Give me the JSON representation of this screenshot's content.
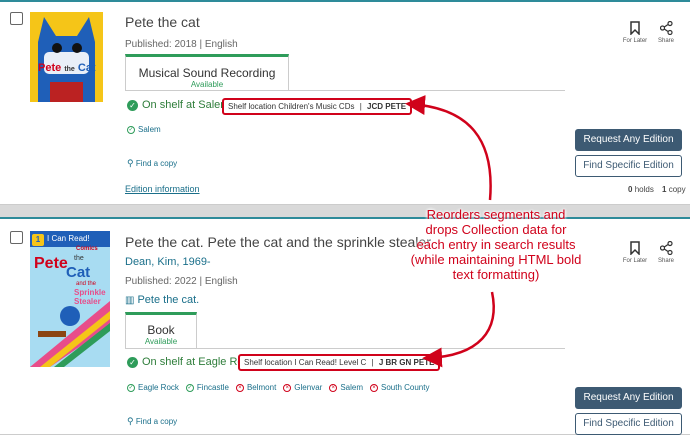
{
  "results": [
    {
      "title": "Pete the cat",
      "author": "",
      "published": "Published: 2018 | English",
      "series": "",
      "format_tab": {
        "label": "Musical Sound Recording",
        "status": "Available"
      },
      "availability": "On shelf at Salem",
      "shelf_location": {
        "prefix": "Shelf location Children's Music CDs",
        "separator": "|",
        "call_number": "JCD PETE"
      },
      "branches": [
        {
          "name": "Salem",
          "status": "available"
        }
      ],
      "find_copy": "Find a copy",
      "edition_info": "Edition information",
      "actions": {
        "for_later": "For Later",
        "share": "Share"
      },
      "buttons": {
        "request": "Request Any Edition",
        "specific": "Find Specific Edition"
      },
      "holds": {
        "holds_count": "0",
        "holds_label": "holds",
        "copy_count": "1",
        "copy_label": "copy"
      },
      "cover_text": [
        "Pete",
        "the",
        "Cat"
      ]
    },
    {
      "title": "Pete the cat. Pete the cat and the sprinkle stealer",
      "author": "Dean, Kim, 1969-",
      "published": "Published: 2022 | English",
      "series": "Pete the cat.",
      "format_tab": {
        "label": "Book",
        "status": "Available"
      },
      "availability": "On shelf at Eagle Rock",
      "shelf_location": {
        "prefix": "Shelf location I Can Read! Level C",
        "separator": "|",
        "call_number": "J BR GN PETE"
      },
      "branches": [
        {
          "name": "Eagle Rock",
          "status": "available"
        },
        {
          "name": "Fincastle",
          "status": "available"
        },
        {
          "name": "Belmont",
          "status": "unavailable"
        },
        {
          "name": "Glenvar",
          "status": "unavailable"
        },
        {
          "name": "Salem",
          "status": "unavailable"
        },
        {
          "name": "South County",
          "status": "unavailable"
        }
      ],
      "find_copy": "Find a copy",
      "actions": {
        "for_later": "For Later",
        "share": "Share"
      },
      "buttons": {
        "request": "Request Any Edition",
        "specific": "Find Specific Edition"
      },
      "cover_text": [
        "I Can Read!",
        "Comics",
        "Pete",
        "the",
        "Cat",
        "and the",
        "Sprinkle",
        "Stealer",
        "1"
      ]
    }
  ],
  "annotation": {
    "lines": [
      "Reorders segments and",
      "drops Collection data for",
      "each entry in search results",
      "(while maintaining HTML bold",
      "text formatting)"
    ]
  },
  "colors": {
    "accent": "#2e8b9a",
    "available": "#2e9c5a",
    "annotation": "#d0021b",
    "button": "#3d5a73"
  }
}
